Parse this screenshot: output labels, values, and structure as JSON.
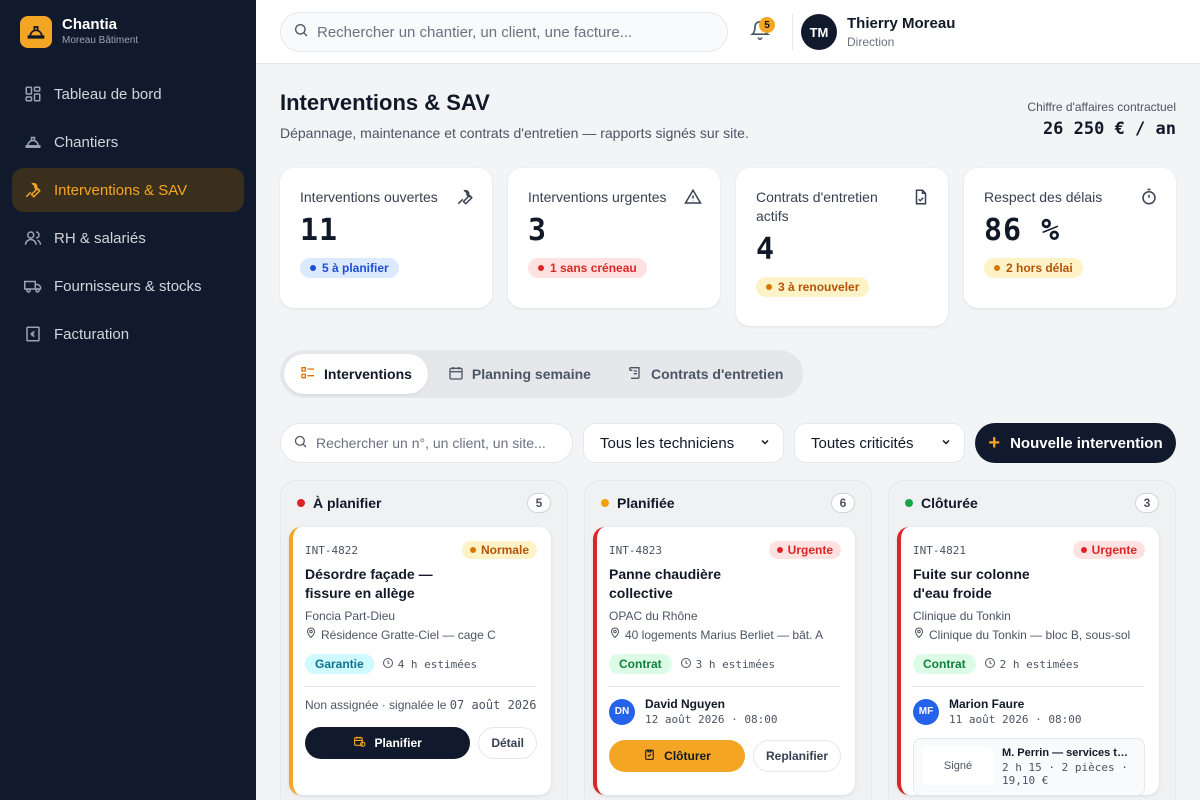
{
  "brand": {
    "name": "Chantia",
    "subtitle": "Moreau Bâtiment"
  },
  "sidebar": {
    "items": [
      {
        "label": "Tableau de bord",
        "icon": "dashboard-icon",
        "active": false
      },
      {
        "label": "Chantiers",
        "icon": "helmet-icon",
        "active": false
      },
      {
        "label": "Interventions & SAV",
        "icon": "wrench-icon",
        "active": true
      },
      {
        "label": "RH & salariés",
        "icon": "users-icon",
        "active": false
      },
      {
        "label": "Fournisseurs & stocks",
        "icon": "truck-icon",
        "active": false
      },
      {
        "label": "Facturation",
        "icon": "invoice-icon",
        "active": false
      }
    ]
  },
  "header": {
    "search_placeholder": "Rechercher un chantier, un client, une facture...",
    "notifications_count": "5",
    "user": {
      "initials": "TM",
      "name": "Thierry Moreau",
      "role": "Direction"
    }
  },
  "page": {
    "title": "Interventions & SAV",
    "subtitle": "Dépannage, maintenance et contrats d'entretien — rapports signés sur site.",
    "revenue_label": "Chiffre d'affaires contractuel",
    "revenue_value": "26 250 € / an"
  },
  "kpis": [
    {
      "label": "Interventions ouvertes",
      "value": "11",
      "badge": "5 à planifier",
      "icon": "wrench-icon"
    },
    {
      "label": "Interventions urgentes",
      "value": "3",
      "badge": "1 sans créneau",
      "icon": "warning-icon"
    },
    {
      "label": "Contrats d'entretien actifs",
      "value": "4",
      "badge": "3 à renouveler",
      "icon": "contract-icon"
    },
    {
      "label": "Respect des délais",
      "value": "86 %",
      "badge": "2 hors délai",
      "icon": "timer-icon"
    }
  ],
  "tabs": [
    {
      "label": "Interventions",
      "active": true
    },
    {
      "label": "Planning semaine",
      "active": false
    },
    {
      "label": "Contrats d'entretien",
      "active": false
    }
  ],
  "filters": {
    "search_placeholder": "Rechercher un n°, un client, un site...",
    "technician": "Tous les techniciens",
    "criticality": "Toutes criticités",
    "new_button": "Nouvelle intervention"
  },
  "columns": [
    {
      "title": "À planifier",
      "count": "5",
      "color": "#dc2626",
      "card": {
        "id": "INT-4822",
        "criticality": "Normale",
        "title": "Désordre façade — fissure en allège",
        "client": "Foncia Part-Dieu",
        "site": "Résidence Gratte-Ciel — cage C",
        "tag": "Garantie",
        "estimate": "4 h estimées",
        "note_prefix": "Non assignée · signalée le ",
        "note_date": "07 août 2026",
        "primary": "Planifier",
        "secondary": "Détail"
      }
    },
    {
      "title": "Planifiée",
      "count": "6",
      "color": "#f59e0b",
      "card": {
        "id": "INT-4823",
        "criticality": "Urgente",
        "title": "Panne chaudière collective",
        "client": "OPAC du Rhône",
        "site": "40 logements Marius Berliet — bât. A",
        "tag": "Contrat",
        "estimate": "3 h estimées",
        "tech_initials": "DN",
        "tech_name": "David Nguyen",
        "tech_date": "12 août 2026 · 08:00",
        "primary": "Clôturer",
        "secondary": "Replanifier"
      }
    },
    {
      "title": "Clôturée",
      "count": "3",
      "color": "#16a34a",
      "card": {
        "id": "INT-4821",
        "criticality": "Urgente",
        "title": "Fuite sur colonne d'eau froide",
        "client": "Clinique du Tonkin",
        "site": "Clinique du Tonkin — bloc B, sous-sol",
        "tag": "Contrat",
        "estimate": "2 h estimées",
        "tech_initials": "MF",
        "tech_name": "Marion Faure",
        "tech_date": "11 août 2026 · 08:00",
        "signed_label": "Signé",
        "signed_name": "M. Perrin — services techniques",
        "signed_detail": "2 h 15 · 2 pièces · 19,10 €"
      }
    }
  ]
}
